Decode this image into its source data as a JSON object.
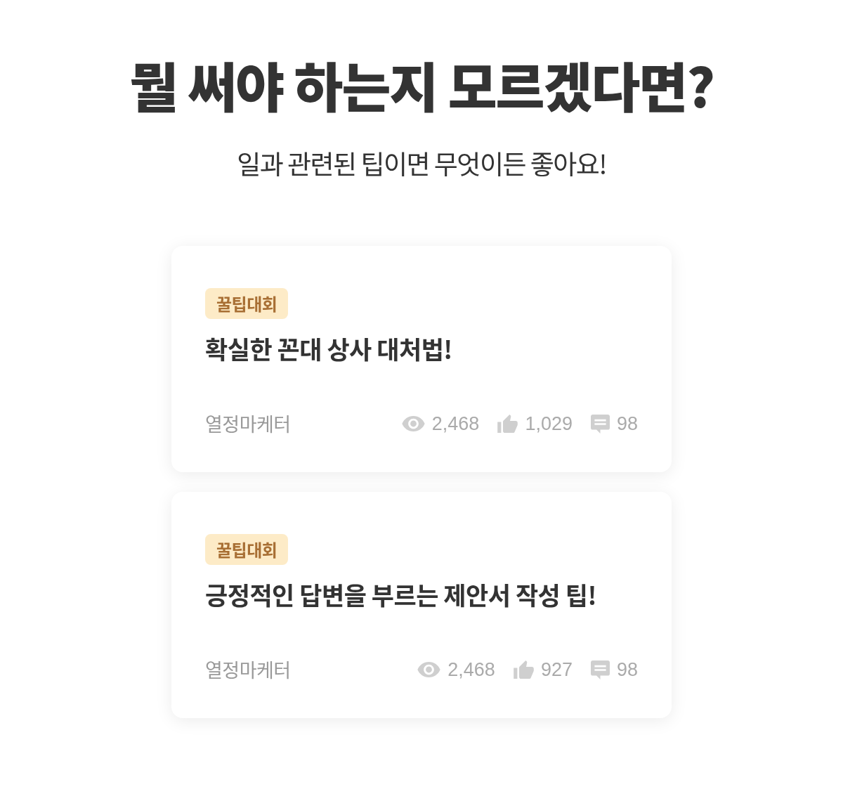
{
  "heading": "뭘 써야 하는지 모르겠다면?",
  "subheading": "일과 관련된 팁이면 무엇이든 좋아요!",
  "posts": [
    {
      "tag": "꿀팁대회",
      "title": "확실한 꼰대 상사 대처법!",
      "author": "열정마케터",
      "stats": [
        {
          "kind": "views",
          "count": "2,468"
        },
        {
          "kind": "likes",
          "count": "1,029"
        },
        {
          "kind": "comments",
          "count": "98"
        }
      ]
    },
    {
      "tag": "꿀팁대회",
      "title": "긍정적인 답변을 부르는 제안서 작성 팁!",
      "author": "열정마케터",
      "stats": [
        {
          "kind": "views",
          "count": "2,468"
        },
        {
          "kind": "likes",
          "count": "927"
        },
        {
          "kind": "comments",
          "count": "98"
        }
      ]
    }
  ]
}
